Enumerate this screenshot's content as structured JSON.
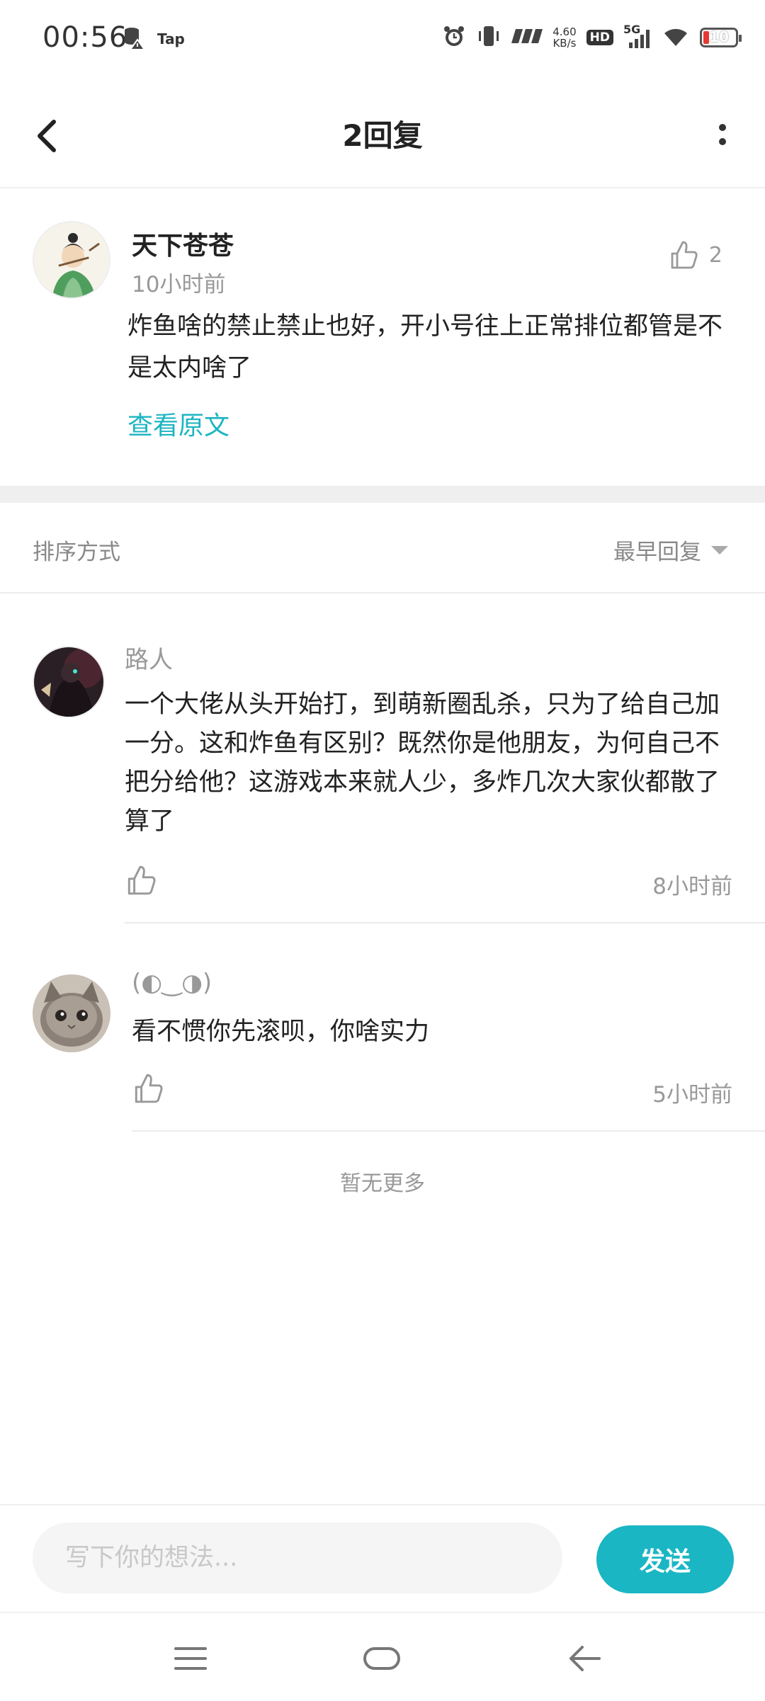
{
  "status_bar": {
    "time": "00:56",
    "tap_label": "Tap",
    "net_speed_value": "4.60",
    "net_speed_unit": "KB/s",
    "hd_label": "HD",
    "signal_label": "5G",
    "battery_level": "10",
    "icons": [
      "storage-icon",
      "alert-icon",
      "tap-app-icon",
      "alarm-icon",
      "vibrate-icon",
      "nfc-speed-icon",
      "hd-icon",
      "signal-icon",
      "wifi-icon",
      "battery-icon"
    ]
  },
  "header": {
    "title": "2回复",
    "back_icon": "chevron-left-icon",
    "more_icon": "more-vertical-icon"
  },
  "original_comment": {
    "author": "天下苍苍",
    "time": "10小时前",
    "like_count": "2",
    "body": "炸鱼啥的禁止禁止也好，开小号往上正常排位都管是不是太内啥了",
    "view_original_label": "查看原文"
  },
  "sort": {
    "label": "排序方式",
    "value": "最早回复"
  },
  "replies": [
    {
      "author": "路人",
      "body": "一个大佬从头开始打，到萌新圈乱杀，只为了给自己加一分。这和炸鱼有区别？既然你是他朋友，为何自己不把分给他？这游戏本来就人少，多炸几次大家伙都散了算了",
      "time": "8小时前"
    },
    {
      "author": "(◐‿◑)",
      "body": "看不惯你先滚呗，你啥实力",
      "time": "5小时前"
    }
  ],
  "footer_note": "暂无更多",
  "input": {
    "placeholder": "写下你的想法...",
    "value": "",
    "send_label": "发送"
  },
  "colors": {
    "accent": "#1ab6c4",
    "link": "#1cb5c2",
    "muted_text": "#999999",
    "battery_low": "#e53935"
  }
}
